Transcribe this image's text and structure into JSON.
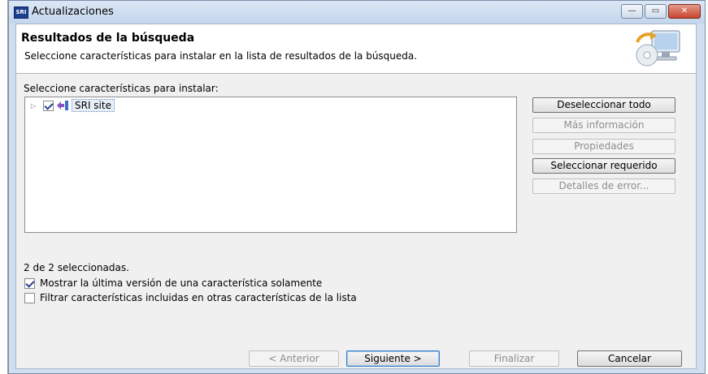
{
  "window": {
    "app_icon_text": "SRI",
    "title": "Actualizaciones",
    "min_glyph": "—",
    "max_glyph": "▭",
    "close_glyph": "✕"
  },
  "header": {
    "title": "Resultados de la búsqueda",
    "subtitle": "Seleccione características para instalar en la lista de resultados de la búsqueda.",
    "icon": "monitor-update-icon"
  },
  "tree": {
    "label": "Seleccione características para instalar:",
    "items": [
      {
        "label": "SRI site",
        "checked": true,
        "expanded": false,
        "icon": "site-icon"
      }
    ]
  },
  "side_buttons": {
    "deselect_all": "Deseleccionar todo",
    "more_info": "Más información",
    "properties": "Propiedades",
    "select_required": "Seleccionar requerido",
    "error_details": "Detalles de error..."
  },
  "status": {
    "selected_count": "2 de 2 seleccionadas."
  },
  "options": {
    "show_latest": {
      "label": "Mostrar la última versión de una característica solamente",
      "checked": true
    },
    "filter_included": {
      "label": "Filtrar características incluidas en otras características de la lista",
      "checked": false
    }
  },
  "footer": {
    "back": "< Anterior",
    "next": "Siguiente >",
    "finish": "Finalizar",
    "cancel": "Cancelar"
  }
}
